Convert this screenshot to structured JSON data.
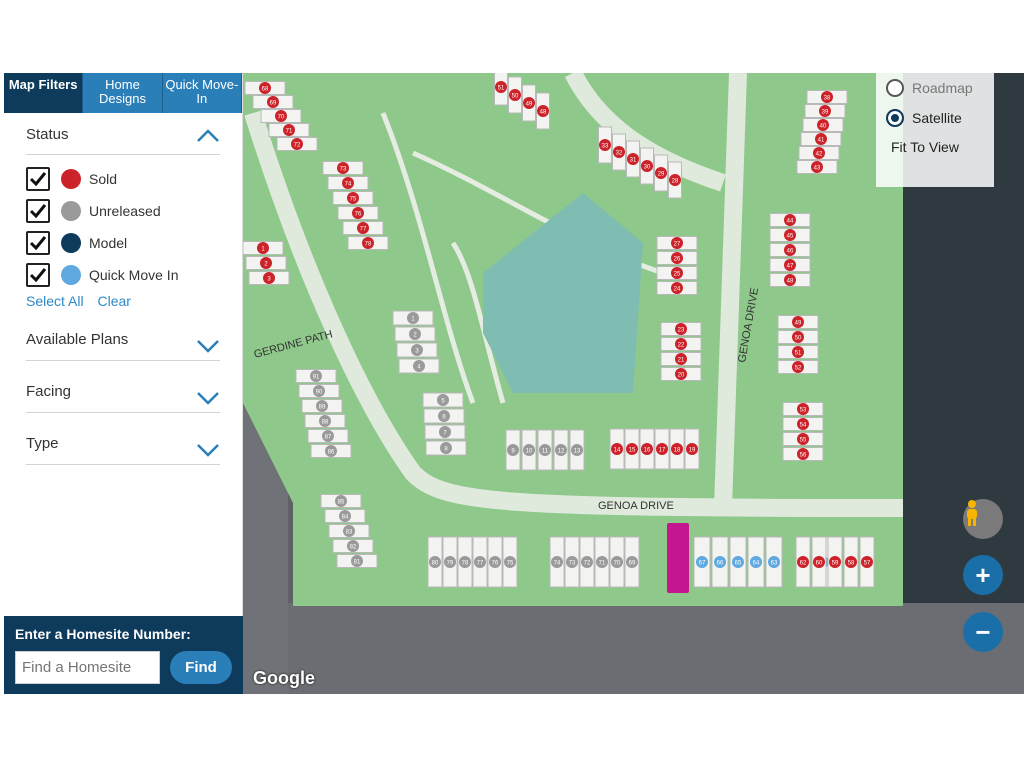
{
  "tabs": [
    {
      "label": "Map Filters",
      "active": true
    },
    {
      "label": "Home Designs",
      "active": false
    },
    {
      "label": "Quick Move-In",
      "active": false
    }
  ],
  "status": {
    "title": "Status",
    "items": [
      {
        "label": "Sold",
        "color": "#cc2229",
        "checked": true
      },
      {
        "label": "Unreleased",
        "color": "#9a9a9a",
        "checked": true
      },
      {
        "label": "Model",
        "color": "#0e3a5c",
        "checked": true
      },
      {
        "label": "Quick Move In",
        "color": "#5fa8e0",
        "checked": true
      }
    ],
    "select_all": "Select All",
    "clear": "Clear"
  },
  "filters": [
    {
      "label": "Available Plans"
    },
    {
      "label": "Facing"
    },
    {
      "label": "Type"
    }
  ],
  "homesite": {
    "title": "Enter a Homesite Number:",
    "placeholder": "Find a Homesite",
    "button": "Find"
  },
  "map_type": {
    "roadmap": "Roadmap",
    "satellite": "Satellite",
    "selected": "Satellite",
    "fit": "Fit To View"
  },
  "streets": {
    "genoa_drive_h": "GENOA DRIVE",
    "genoa_drive_v": "GENOA DRIVE",
    "gerdine_path": "GERDINE PATH"
  },
  "google": "Google",
  "zoom_in": "+",
  "zoom_out": "−",
  "colors": {
    "sold": "#cc2229",
    "unreleased": "#9a9a9a",
    "model": "#0e3a5c",
    "quick_move_in": "#5fa8e0",
    "highlight": "#c4168f",
    "accent": "#2b7fb8",
    "dark": "#0e3a5c"
  },
  "lots": {
    "top_left_col": [
      "68",
      "69",
      "70",
      "71",
      "72"
    ],
    "top_row": [
      "51",
      "50",
      "49",
      "48"
    ],
    "model_group": [
      "33",
      "32",
      "31",
      "30",
      "29",
      "28"
    ],
    "right_top_col": [
      "38",
      "39",
      "40",
      "41",
      "42",
      "43"
    ],
    "left_col_upper": [
      "73",
      "74",
      "75",
      "76",
      "77",
      "78"
    ],
    "left_col_lower": [
      "1",
      "2",
      "3"
    ],
    "center_group_a": [
      "27",
      "26",
      "25",
      "24"
    ],
    "right_group_a": [
      "44",
      "45",
      "46",
      "47",
      "48"
    ],
    "center_group_b": [
      "23",
      "22",
      "21",
      "20"
    ],
    "right_group_b": [
      "49",
      "50",
      "51",
      "52"
    ],
    "right_group_c": [
      "53",
      "54",
      "55",
      "56"
    ],
    "mid_unreleased_1": [
      "1",
      "2",
      "3",
      "4"
    ],
    "mid_unreleased_2": [
      "5",
      "6",
      "7",
      "8"
    ],
    "left_unreleased": [
      "91",
      "90",
      "89",
      "88",
      "87",
      "86"
    ],
    "row_unreleased": [
      "9",
      "10",
      "11",
      "12",
      "13"
    ],
    "row_sold": [
      "14",
      "15",
      "16",
      "17",
      "18",
      "19"
    ],
    "bottom_left_diag": [
      "85",
      "84",
      "83",
      "82",
      "81"
    ],
    "bottom_unreleased": [
      "80",
      "79",
      "78",
      "77",
      "76",
      "75"
    ],
    "bottom_mid": [
      "74",
      "73",
      "72",
      "71",
      "70",
      "69"
    ],
    "bottom_qmi": [
      "67",
      "66",
      "65",
      "64",
      "63"
    ],
    "bottom_right_qmi": [
      "61"
    ],
    "bottom_right_sold": [
      "62",
      "60",
      "59",
      "58",
      "57"
    ],
    "highlighted": "68"
  }
}
